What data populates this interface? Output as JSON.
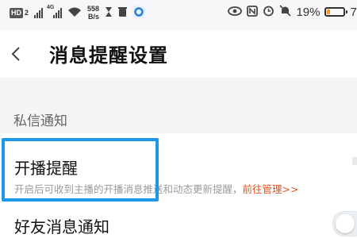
{
  "status_bar": {
    "hd": "HD",
    "sim": "2",
    "network": "4G",
    "speed_value": "558",
    "speed_unit": "B/s",
    "battery_percent": "19%",
    "battery_level": 0.19,
    "battery_color": "#f29a1f",
    "time": "7:"
  },
  "header": {
    "back_icon": "chevron-left-icon",
    "title": "消息提醒设置"
  },
  "section": {
    "label": "私信通知"
  },
  "settings": {
    "live_reminder": {
      "title": "开播提醒",
      "description": "开启后可收到主播的开播消息推送和动态更新提醒，",
      "link": "前往管理>>",
      "link_color": "#e0531f"
    },
    "friend_message": {
      "title": "好友消息通知",
      "toggle_on": false
    }
  },
  "highlight_color": "#1d98e8"
}
